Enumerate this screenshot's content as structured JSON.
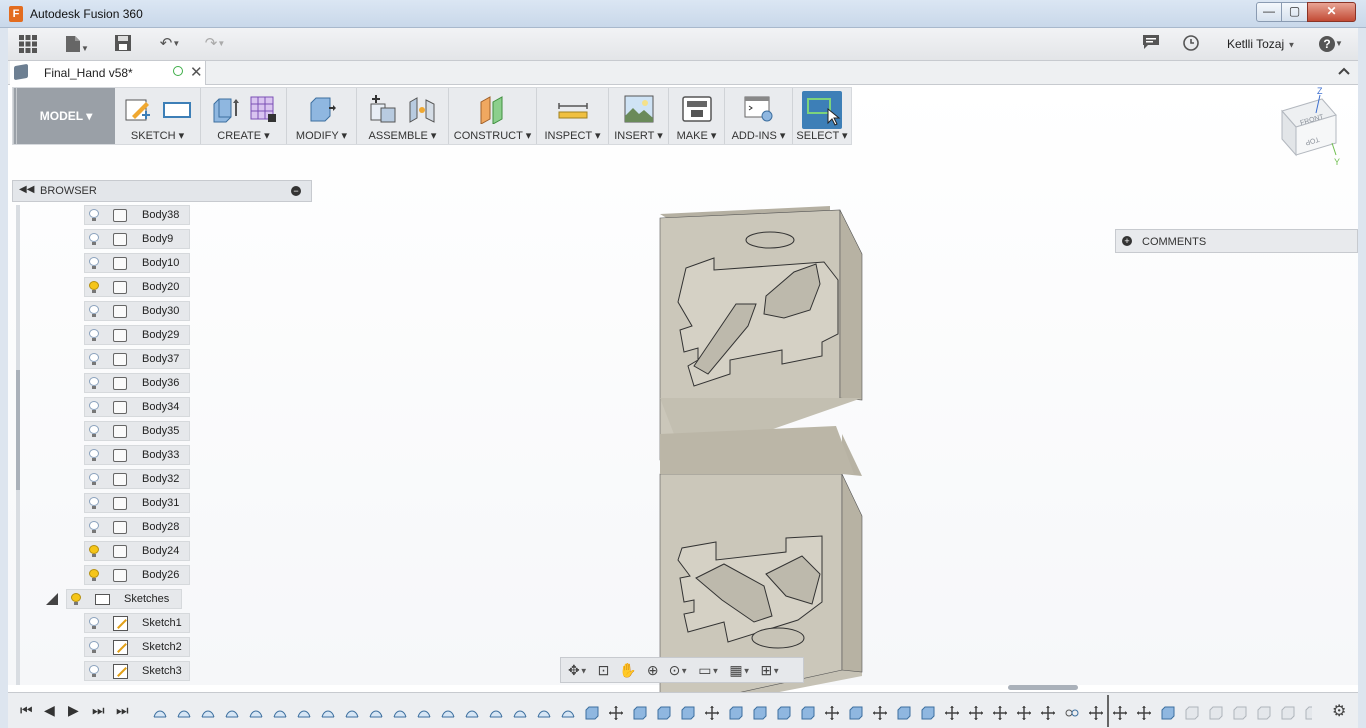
{
  "window": {
    "title": "Autodesk Fusion 360",
    "logo": "F",
    "buttons": {
      "minimize": "—",
      "maximize": "▢",
      "close": "✕"
    }
  },
  "qab": {
    "icons": [
      "grid-icon",
      "file-icon",
      "save-icon",
      "undo-icon",
      "redo-icon"
    ],
    "right_icons": [
      "comment-icon",
      "clock-icon",
      "help-icon"
    ],
    "user": "Ketlli Tozaj",
    "help": "?"
  },
  "tab": {
    "name": "Final_Hand v58*"
  },
  "toolbar": {
    "workspace": "MODEL ▾",
    "groups": [
      "SKETCH ▾",
      "CREATE ▾",
      "MODIFY ▾",
      "ASSEMBLE ▾",
      "CONSTRUCT ▾",
      "INSPECT ▾",
      "INSERT ▾",
      "MAKE ▾",
      "ADD-INS ▾",
      "SELECT ▾"
    ]
  },
  "browser": {
    "title": "BROWSER",
    "bodies": [
      {
        "label": "Body38",
        "visible": false
      },
      {
        "label": "Body9",
        "visible": false
      },
      {
        "label": "Body10",
        "visible": false
      },
      {
        "label": "Body20",
        "visible": true
      },
      {
        "label": "Body30",
        "visible": false
      },
      {
        "label": "Body29",
        "visible": false
      },
      {
        "label": "Body37",
        "visible": false
      },
      {
        "label": "Body36",
        "visible": false
      },
      {
        "label": "Body34",
        "visible": false
      },
      {
        "label": "Body35",
        "visible": false
      },
      {
        "label": "Body33",
        "visible": false
      },
      {
        "label": "Body32",
        "visible": false
      },
      {
        "label": "Body31",
        "visible": false
      },
      {
        "label": "Body28",
        "visible": false
      },
      {
        "label": "Body24",
        "visible": true
      },
      {
        "label": "Body26",
        "visible": true
      }
    ],
    "sketches_folder": "Sketches",
    "sketches": [
      "Sketch1",
      "Sketch2",
      "Sketch3"
    ]
  },
  "comments": {
    "label": "COMMENTS"
  },
  "viewcube": {
    "front": "FRONT",
    "top": "TOP",
    "axis_z": "Z",
    "axis_y": "Y"
  },
  "colors": {
    "accent": "#3d7fb7",
    "workspace": "#9aa0a7",
    "mold": "#c9c5b8",
    "bulb_on": "#f5c518"
  }
}
